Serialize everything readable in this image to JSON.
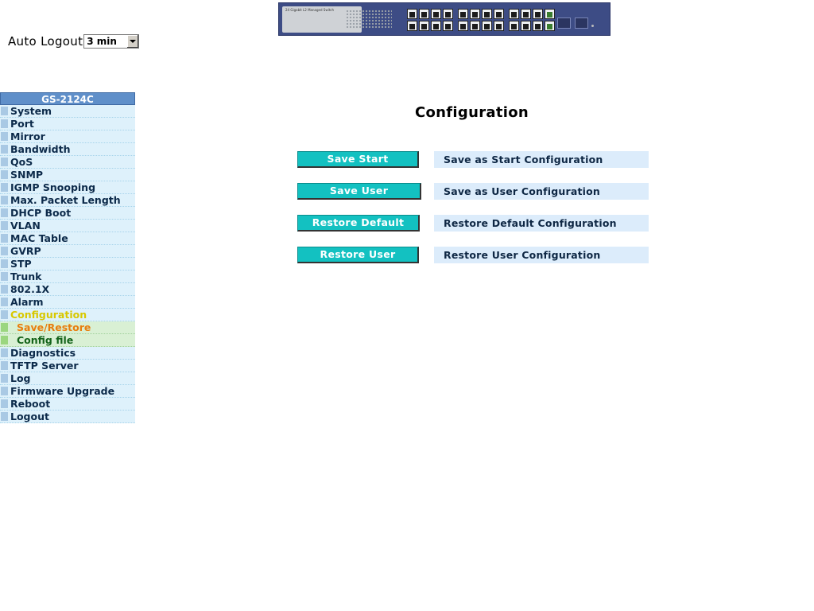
{
  "header": {
    "device_model_caption": "24 Gigabit L2 Managed Switch"
  },
  "auto_logout": {
    "label": "Auto Logout",
    "selected": "3 min"
  },
  "sidebar": {
    "title": "GS-2124C",
    "items": [
      {
        "label": "System"
      },
      {
        "label": "Port"
      },
      {
        "label": "Mirror"
      },
      {
        "label": "Bandwidth"
      },
      {
        "label": "QoS"
      },
      {
        "label": "SNMP"
      },
      {
        "label": "IGMP Snooping"
      },
      {
        "label": "Max. Packet Length"
      },
      {
        "label": "DHCP Boot"
      },
      {
        "label": "VLAN"
      },
      {
        "label": "MAC Table"
      },
      {
        "label": "GVRP"
      },
      {
        "label": "STP"
      },
      {
        "label": "Trunk"
      },
      {
        "label": "802.1X"
      },
      {
        "label": "Alarm"
      },
      {
        "label": "Configuration"
      },
      {
        "label": "Save/Restore"
      },
      {
        "label": "Config file"
      },
      {
        "label": "Diagnostics"
      },
      {
        "label": "TFTP Server"
      },
      {
        "label": "Log"
      },
      {
        "label": "Firmware Upgrade"
      },
      {
        "label": "Reboot"
      },
      {
        "label": "Logout"
      }
    ]
  },
  "main": {
    "title": "Configuration",
    "actions": [
      {
        "button": "Save Start",
        "description": "Save as Start Configuration"
      },
      {
        "button": "Save User",
        "description": "Save as User Configuration"
      },
      {
        "button": "Restore Default",
        "description": "Restore Default Configuration"
      },
      {
        "button": "Restore User",
        "description": "Restore User Configuration"
      }
    ]
  },
  "colors": {
    "sidebar_header": "#5f8fc9",
    "sidebar_item_bg": "#def1fb",
    "sidebar_active": "#d8c800",
    "sidebar_sub_selected": "#e87d0d",
    "sidebar_sub_normal": "#14631a",
    "action_button": "#13c1c1",
    "action_desc_bg": "#dcecfb"
  }
}
